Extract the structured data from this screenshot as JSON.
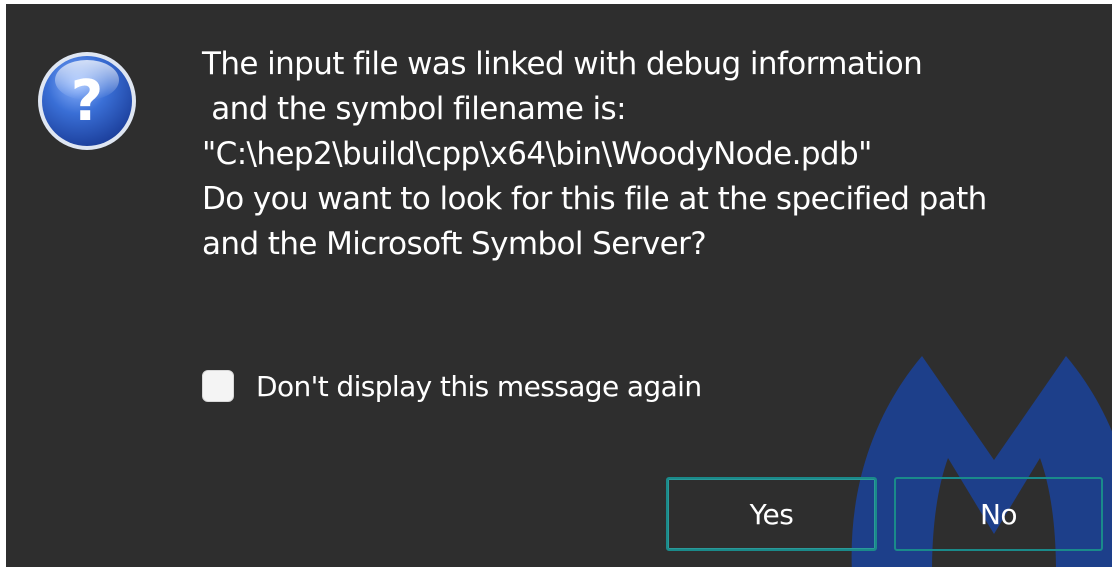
{
  "dialog": {
    "message_lines": [
      "The input file was linked with debug information",
      " and the symbol filename is:",
      "\"C:\\hep2\\build\\cpp\\x64\\bin\\WoodyNode.pdb\"",
      "Do you want to look for this file at the specified path",
      "and the Microsoft Symbol Server?"
    ],
    "message": "The input file was linked with debug information\n and the symbol filename is:\n\"C:\\hep2\\build\\cpp\\x64\\bin\\WoodyNode.pdb\"\nDo you want to look for this file at the specified path\nand the Microsoft Symbol Server?",
    "icon": "question-icon",
    "checkbox": {
      "label": "Don't display this message again",
      "checked": false
    },
    "buttons": {
      "yes_label": "Yes",
      "no_label": "No"
    }
  },
  "colors": {
    "background": "#2e2e2e",
    "text": "#ffffff",
    "button_border": "#1a8a8a",
    "watermark": "#1d3f8a",
    "icon_blue": "#2a5fc4"
  }
}
